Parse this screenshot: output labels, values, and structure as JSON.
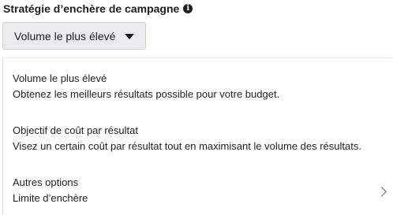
{
  "header": {
    "title": "Stratégie d’enchère de campagne",
    "info_icon": "info-icon"
  },
  "dropdown": {
    "selected_label": "Volume le plus élevé",
    "caret_icon": "caret-down-icon"
  },
  "menu": {
    "options": [
      {
        "title": "Volume le plus élevé",
        "desc": "Obtenez les meilleurs résultats possible pour votre budget."
      },
      {
        "title": "Objectif de coût par résultat",
        "desc": "Visez un certain coût par résultat tout en maximisant le volume des résultats."
      },
      {
        "title": "Autres options",
        "desc": "Limite d’enchère",
        "icon": "chevron-right-icon"
      }
    ]
  }
}
